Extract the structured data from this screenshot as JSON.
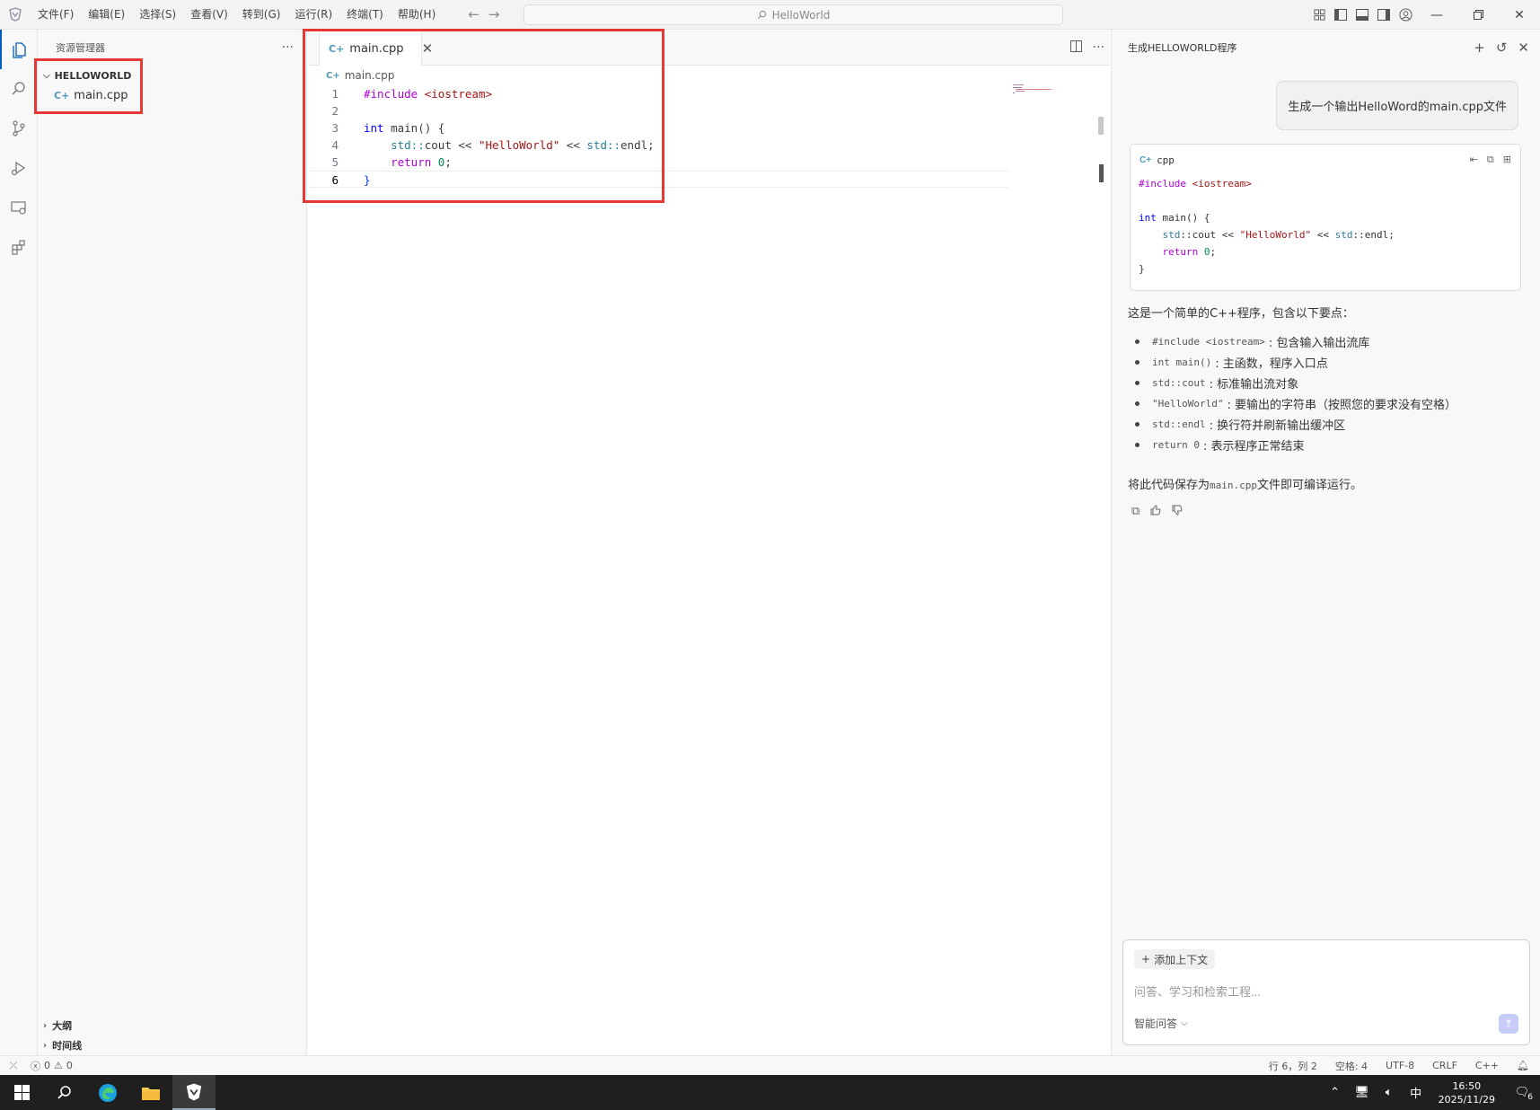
{
  "menu": [
    "文件(F)",
    "编辑(E)",
    "选择(S)",
    "查看(V)",
    "转到(G)",
    "运行(R)",
    "终端(T)",
    "帮助(H)"
  ],
  "command_center": {
    "text": "HelloWorld"
  },
  "sidebar": {
    "title": "资源管理器",
    "folder": "HELLOWORLD",
    "files": [
      "main.cpp"
    ],
    "sections": [
      "大纲",
      "时间线"
    ]
  },
  "editor": {
    "tab_label": "main.cpp",
    "breadcrumb": "main.cpp",
    "line_numbers": [
      "1",
      "2",
      "3",
      "4",
      "5",
      "6"
    ],
    "code": {
      "l1_dir": "#include",
      "l1_rest": " <iostream>",
      "l3_kw": "int",
      "l3_rest": " main() {",
      "l4_indent": "    ",
      "l4_ns": "std::",
      "l4_mid": "cout << ",
      "l4_str": "\"HelloWorld\"",
      "l4_tail": " << ",
      "l4_ns2": "std::",
      "l4_end": "endl;",
      "l5_indent": "    ",
      "l5_kw": "return",
      "l5_sp": " ",
      "l5_num": "0",
      "l5_end": ";",
      "l6": "}"
    }
  },
  "chat": {
    "title": "生成HELLOWORLD程序",
    "user_message": "生成一个输出HelloWord的main.cpp文件",
    "code_block": {
      "language": "cpp",
      "lines": [
        "#include <iostream>",
        "",
        "int main() {",
        "    std::cout << \"HelloWorld\" << std::endl;",
        "    return 0;",
        "}"
      ]
    },
    "intro": "这是一个简单的C++程序，包含以下要点：",
    "points": [
      {
        "code": "#include <iostream>",
        "desc": ": 包含输入输出流库"
      },
      {
        "code": "int main()",
        "desc": ": 主函数，程序入口点"
      },
      {
        "code": "std::cout",
        "desc": ": 标准输出流对象"
      },
      {
        "code": "\"HelloWorld\"",
        "desc": ": 要输出的字符串（按照您的要求没有空格）"
      },
      {
        "code": "std::endl",
        "desc": ": 换行符并刷新输出缓冲区"
      },
      {
        "code": "return 0",
        "desc": ": 表示程序正常结束"
      }
    ],
    "outro_pre": "将此代码保存为",
    "outro_code": "main.cpp",
    "outro_post": "文件即可编译运行。",
    "add_context": "添加上下文",
    "input_placeholder": "问答、学习和检索工程...",
    "mode": "智能问答"
  },
  "statusbar": {
    "errors": "0",
    "warnings": "0",
    "position": "行 6，列 2",
    "spaces": "空格: 4",
    "encoding": "UTF-8",
    "eol": "CRLF",
    "language": "C++"
  },
  "taskbar": {
    "ime": "中",
    "time": "16:50",
    "date": "2025/11/29",
    "notifications": "6"
  },
  "colors": {
    "highlight_box": "#e53935",
    "accent": "#005fb8",
    "send_button": "#c7cdf9"
  }
}
